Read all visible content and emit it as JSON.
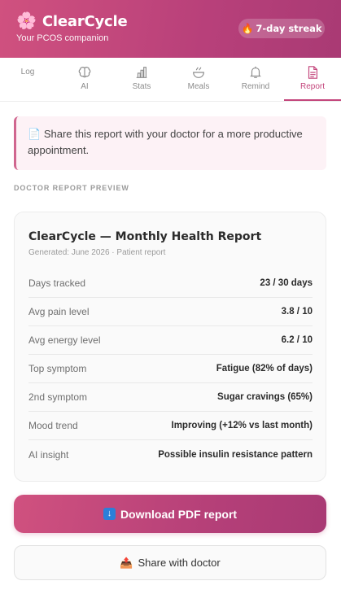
{
  "app": {
    "name": "ClearCycle",
    "tagline": "Your PCOS companion",
    "streak": "7-day streak"
  },
  "tabs": [
    {
      "label": "Log",
      "icon": "log",
      "active": false
    },
    {
      "label": "AI",
      "icon": "brain-icon",
      "active": false
    },
    {
      "label": "Stats",
      "icon": "bar-chart-icon",
      "active": false
    },
    {
      "label": "Meals",
      "icon": "bowl-icon",
      "active": false
    },
    {
      "label": "Remind",
      "icon": "bell-icon",
      "active": false
    },
    {
      "label": "Report",
      "icon": "document-icon",
      "active": true
    }
  ],
  "notice": {
    "text": "Share this report with your doctor for a more productive appointment."
  },
  "section_label": "Doctor report preview",
  "report": {
    "title": "ClearCycle — Monthly Health Report",
    "subtitle": "Generated: June 2026 · Patient report",
    "rows": [
      {
        "key": "Days tracked",
        "value": "23 / 30 days"
      },
      {
        "key": "Avg pain level",
        "value": "3.8 / 10"
      },
      {
        "key": "Avg energy level",
        "value": "6.2 / 10"
      },
      {
        "key": "Top symptom",
        "value": "Fatigue (82% of days)"
      },
      {
        "key": "2nd symptom",
        "value": "Sugar cravings (65%)"
      },
      {
        "key": "Mood trend",
        "value": "Improving (+12% vs last month)"
      },
      {
        "key": "AI insight",
        "value": "Possible insulin resistance pattern"
      }
    ]
  },
  "actions": {
    "download_label": "Download PDF report",
    "share_label": "Share with doctor"
  },
  "colors": {
    "brand_pink": "#c4467c",
    "header_gradient_start": "#d0517f",
    "header_gradient_end": "#a93a74",
    "notice_bg": "#fdf2f6"
  }
}
